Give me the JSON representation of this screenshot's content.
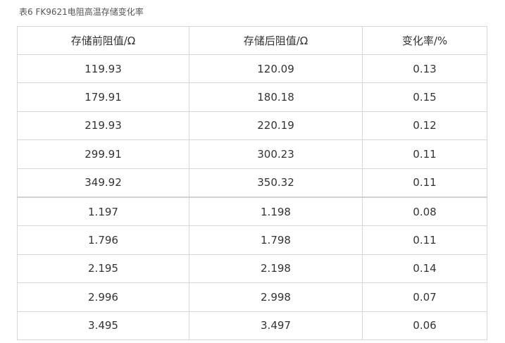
{
  "caption": "表6  FK9621电阻高温存储变化率",
  "table": {
    "headers": [
      "存储前阻值/Ω",
      "存储后阻值/Ω",
      "变化率/%"
    ],
    "rows": [
      [
        "119.93",
        "120.09",
        "0.13"
      ],
      [
        "179.91",
        "180.18",
        "0.15"
      ],
      [
        "219.93",
        "220.19",
        "0.12"
      ],
      [
        "299.91",
        "300.23",
        "0.11"
      ],
      [
        "349.92",
        "350.32",
        "0.11"
      ],
      [
        "1.197",
        "1.198",
        "0.08"
      ],
      [
        "1.796",
        "1.798",
        "0.11"
      ],
      [
        "2.195",
        "2.198",
        "0.14"
      ],
      [
        "2.996",
        "2.998",
        "0.07"
      ],
      [
        "3.495",
        "3.497",
        "0.06"
      ]
    ]
  }
}
